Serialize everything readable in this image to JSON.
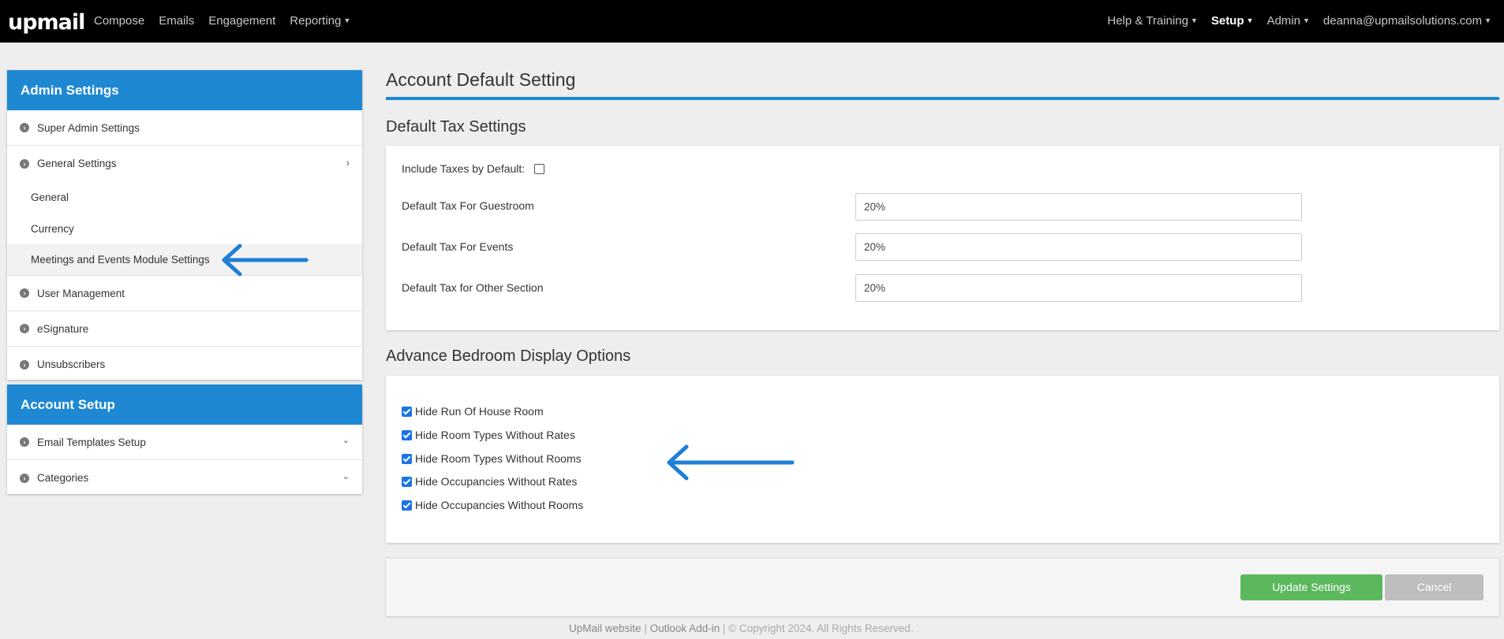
{
  "topnav": {
    "logo": "upmail",
    "left_items": [
      "Compose",
      "Emails",
      "Engagement",
      "Reporting"
    ],
    "right_items": {
      "help": "Help & Training",
      "setup": "Setup",
      "admin": "Admin",
      "user": "deanna@upmailsolutions.com"
    }
  },
  "sidebar": {
    "admin_title": "Admin Settings",
    "admin_items": {
      "super_admin": "Super Admin Settings",
      "general_settings": "General Settings",
      "general": "General",
      "currency": "Currency",
      "meetings": "Meetings and Events Module Settings",
      "user_management": "User Management",
      "esignature": "eSignature",
      "unsubscribers": "Unsubscribers"
    },
    "account_title": "Account Setup",
    "account_items": {
      "email_templates": "Email Templates Setup",
      "categories": "Categories"
    }
  },
  "main": {
    "title": "Account Default Setting",
    "tax": {
      "section_title": "Default Tax Settings",
      "include_label": "Include Taxes by Default:",
      "guestroom_label": "Default Tax For Guestroom",
      "guestroom_value": "20%",
      "events_label": "Default Tax For Events",
      "events_value": "20%",
      "other_label": "Default Tax for Other Section",
      "other_value": "20%"
    },
    "bedroom": {
      "section_title": "Advance Bedroom Display Options",
      "options": [
        "Hide Run Of House Room",
        "Hide Room Types Without Rates",
        "Hide Room Types Without Rooms",
        "Hide Occupancies Without Rates",
        "Hide Occupancies Without Rooms"
      ]
    },
    "buttons": {
      "update": "Update Settings",
      "cancel": "Cancel"
    }
  },
  "footer": {
    "website": "UpMail website",
    "sep": " | ",
    "outlook": "Outlook Add-in",
    "copyright": " | © Copyright 2024. All Rights Reserved."
  },
  "colors": {
    "accent": "#1e88d2",
    "update_button": "#5cb85c",
    "cancel_button": "#bdbdbd"
  }
}
